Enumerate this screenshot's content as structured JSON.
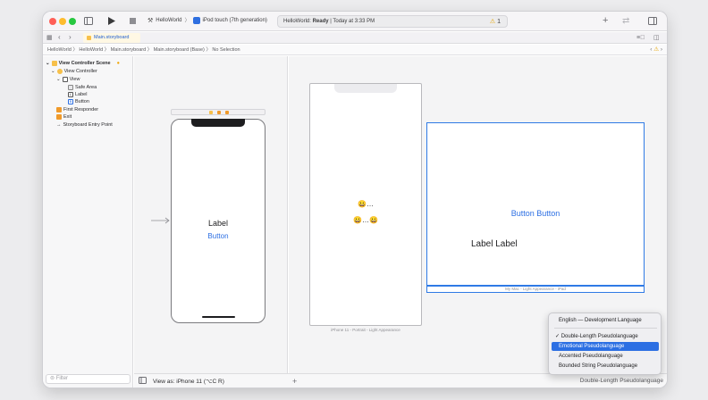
{
  "toolbar": {
    "scheme_project": "HelloWorld",
    "scheme_device": "iPod touch (7th generation)",
    "status_project": "HelloWorld:",
    "status_state": "Ready",
    "status_time": "| Today at 3:33 PM",
    "warning_count": "1"
  },
  "tab": {
    "active_label": "Main.storyboard"
  },
  "jumpbar": {
    "path": "HelloWorld 〉 HelloWorld 〉 Main.storyboard 〉 Main.storyboard (Base) 〉 No Selection"
  },
  "outline": {
    "items": [
      {
        "label": "View Controller Scene"
      },
      {
        "label": "View Controller"
      },
      {
        "label": "View"
      },
      {
        "label": "Safe Area"
      },
      {
        "label": "Label"
      },
      {
        "label": "Button"
      },
      {
        "label": "First Responder"
      },
      {
        "label": "Exit"
      },
      {
        "label": "Storyboard Entry Point"
      }
    ],
    "filter_placeholder": "Filter"
  },
  "canvas": {
    "label_text": "Label",
    "button_text": "Button",
    "view_as": "View as: iPhone 11 (",
    "view_as_suffix": "C R)"
  },
  "preview_iphone": {
    "emoji_label": "😀…",
    "emoji_button": "😀…😀",
    "caption": "iPhone 11 - Portrait - Light Appearance"
  },
  "preview_mac": {
    "button_text": "Button Button",
    "label_text": "Label Label",
    "caption": "My Mac - Light Appearance - iPad"
  },
  "language_menu": {
    "items": [
      {
        "label": "English — Development Language",
        "checked": false
      },
      {
        "label": "✓ Double-Length Pseudolanguage",
        "checked": true
      },
      {
        "label": "Emotional Pseudolanguage",
        "checked": false,
        "highlighted": true
      },
      {
        "label": "Accented Pseudolanguage",
        "checked": false
      },
      {
        "label": "Bounded String Pseudolanguage",
        "checked": false
      }
    ],
    "current_selection": "Double-Length Pseudolanguage"
  },
  "colors": {
    "accent": "#2c6fe3",
    "warning": "#e6a400",
    "storyboard": "#f7c04a"
  }
}
